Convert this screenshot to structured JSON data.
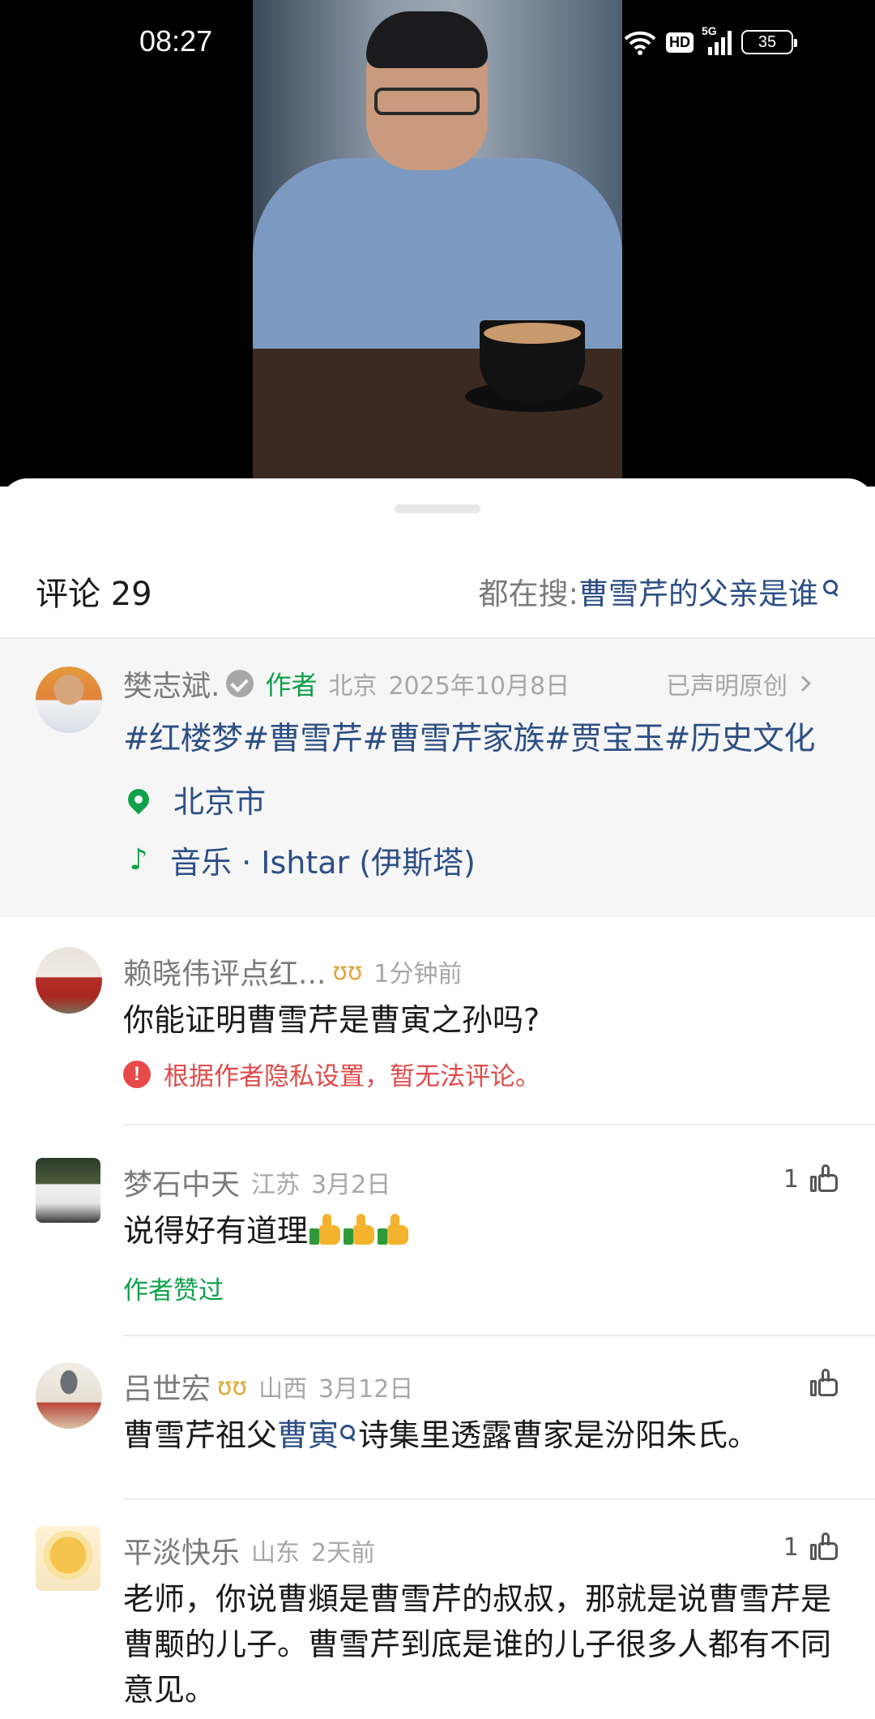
{
  "status_bar": {
    "time": "08:27",
    "hd": "HD",
    "network": "5G",
    "battery": "35"
  },
  "sheet": {
    "comment_count_label": "评论 29",
    "search_prefix": "都在搜: ",
    "search_query": "曹雪芹的父亲是谁"
  },
  "author_card": {
    "name": "樊志斌.",
    "author_tag": "作者",
    "location": "北京",
    "date": "2025年10月8日",
    "declared": "已声明原创",
    "hashtags": "#红楼梦#曹雪芹#曹雪芹家族#贾宝玉#历史文化",
    "place": "北京市",
    "music": "音乐 · Ishtar (伊斯塔)"
  },
  "comments": [
    {
      "name": "赖晓伟评点红...",
      "medal": "ʊʊ",
      "time": "1分钟前",
      "text": "你能证明曹雪芹是曹寅之孙吗?",
      "warning": "根据作者隐私设置，暂无法评论。"
    },
    {
      "name": "梦石中天",
      "location": "江苏",
      "date": "3月2日",
      "likes": "1",
      "text": "说得好有道理",
      "author_liked": "作者赞过"
    },
    {
      "name": "吕世宏",
      "medal": "ʊʊ",
      "location": "山西",
      "date": "3月12日",
      "text_before": "曹雪芹祖父",
      "keyword": "曹寅",
      "text_after": "诗集里透露曹家是汾阳朱氏。"
    },
    {
      "name": "平淡快乐",
      "location": "山东",
      "date": "2天前",
      "likes": "1",
      "text": "老师，你说曹頫是曹雪芹的叔叔，那就是说曹雪芹是曹颙的儿子。曹雪芹到底是谁的儿子很多人都有不同意见。"
    }
  ]
}
